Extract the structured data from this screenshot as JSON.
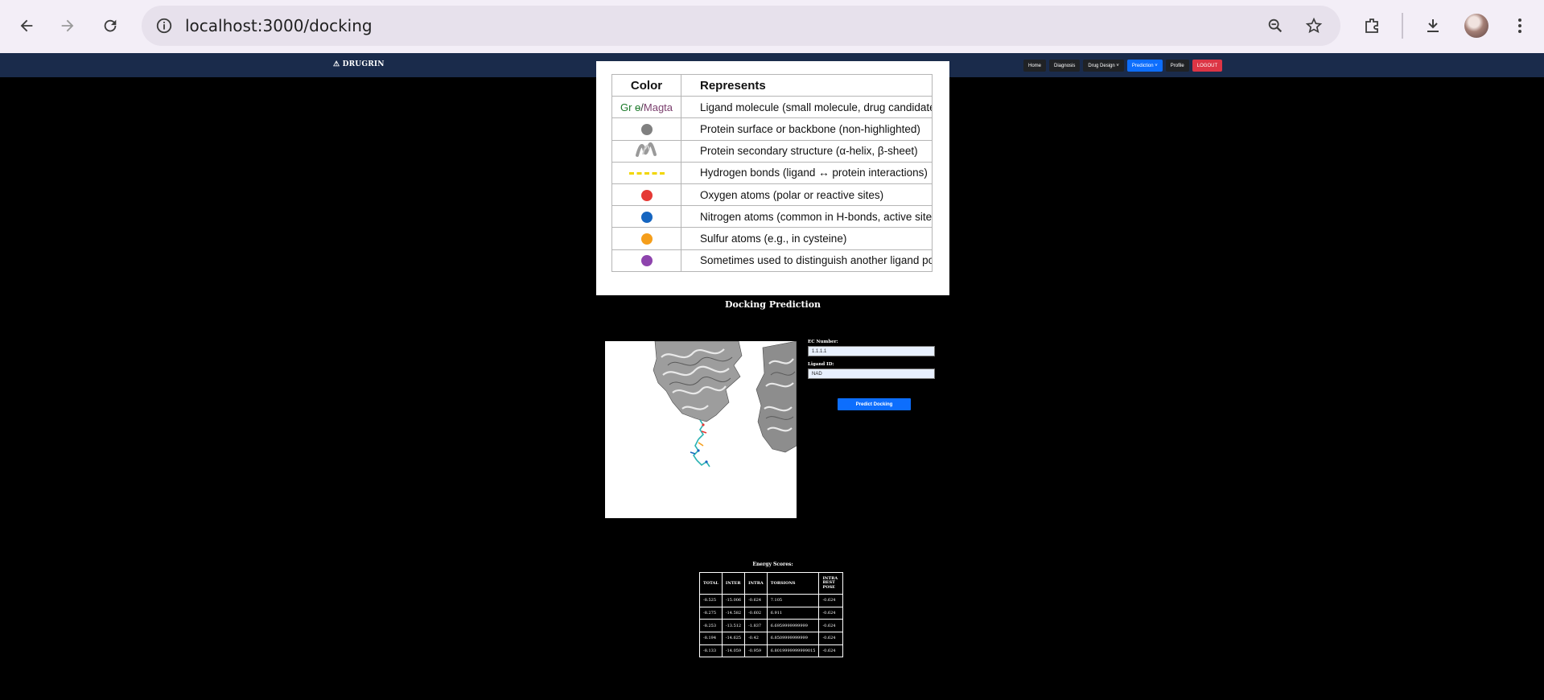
{
  "browser": {
    "url": "localhost:3000/docking"
  },
  "nav": {
    "brand": "⚠ DRUGRIN",
    "buttons": [
      {
        "label": "Home"
      },
      {
        "label": "Diagnosis"
      },
      {
        "label": "Drug Design ˅"
      },
      {
        "label": "Prediction ˅"
      },
      {
        "label": "Profile"
      },
      {
        "label": "LOGOUT"
      }
    ]
  },
  "legend": {
    "headers": {
      "color": "Color",
      "represents": "Represents"
    },
    "rows": [
      {
        "key": "Gr ɵ/Magta",
        "text": "Ligand molecule (small molecule, drug candidate)"
      },
      {
        "key": "",
        "text": "Protein surface or backbone (non-highlighted)"
      },
      {
        "key": "",
        "text": "Protein secondary structure (α-helix, β-sheet)"
      },
      {
        "key": "",
        "text": "Hydrogen bonds (ligand ↔ protein interactions)"
      },
      {
        "key": "",
        "text": "Oxygen atoms (polar or reactive sites)"
      },
      {
        "key": "",
        "text": "Nitrogen atoms (common in H-bonds, active sites)"
      },
      {
        "key": "",
        "text": "Sulfur atoms (e.g., in cysteine)"
      },
      {
        "key": "",
        "text": "Sometimes used to distinguish another ligand po"
      }
    ],
    "colors": {
      "protein_surface": "#808080",
      "oxygen": "#e53935",
      "nitrogen": "#1565c0",
      "sulfur": "#f59e1b",
      "ligand_alt": "#8e44ad",
      "hbond": "#f2d600",
      "ligand_green": "#1b7a2a",
      "ligand_magenta": "#7b3f6e"
    }
  },
  "docking": {
    "title": "Docking Prediction",
    "ec_label": "EC Number:",
    "ec_value": "1.1.1.1",
    "ligand_label": "Ligand ID:",
    "ligand_value": "NAD",
    "predict_button": "Predict Docking"
  },
  "energy": {
    "title": "Energy Scores:",
    "headers": [
      "TOTAL",
      "INTER",
      "INTRA",
      "TORSIONS",
      "INTRA BEST POSE"
    ],
    "rows": [
      [
        "-8.525",
        "-15.006",
        "-0.624",
        "7.105",
        "-0.624"
      ],
      [
        "-8.275",
        "-14.582",
        "-0.602",
        "6.911",
        "-0.624"
      ],
      [
        "-8.253",
        "-13.512",
        "-1.837",
        "6.6959999999999",
        "-0.624"
      ],
      [
        "-8.194",
        "-14.625",
        "-0.42",
        "6.8509999999999",
        "-0.624"
      ],
      [
        "-8.133",
        "-14.059",
        "-0.959",
        "6.8019999999999015",
        "-0.624"
      ]
    ]
  }
}
